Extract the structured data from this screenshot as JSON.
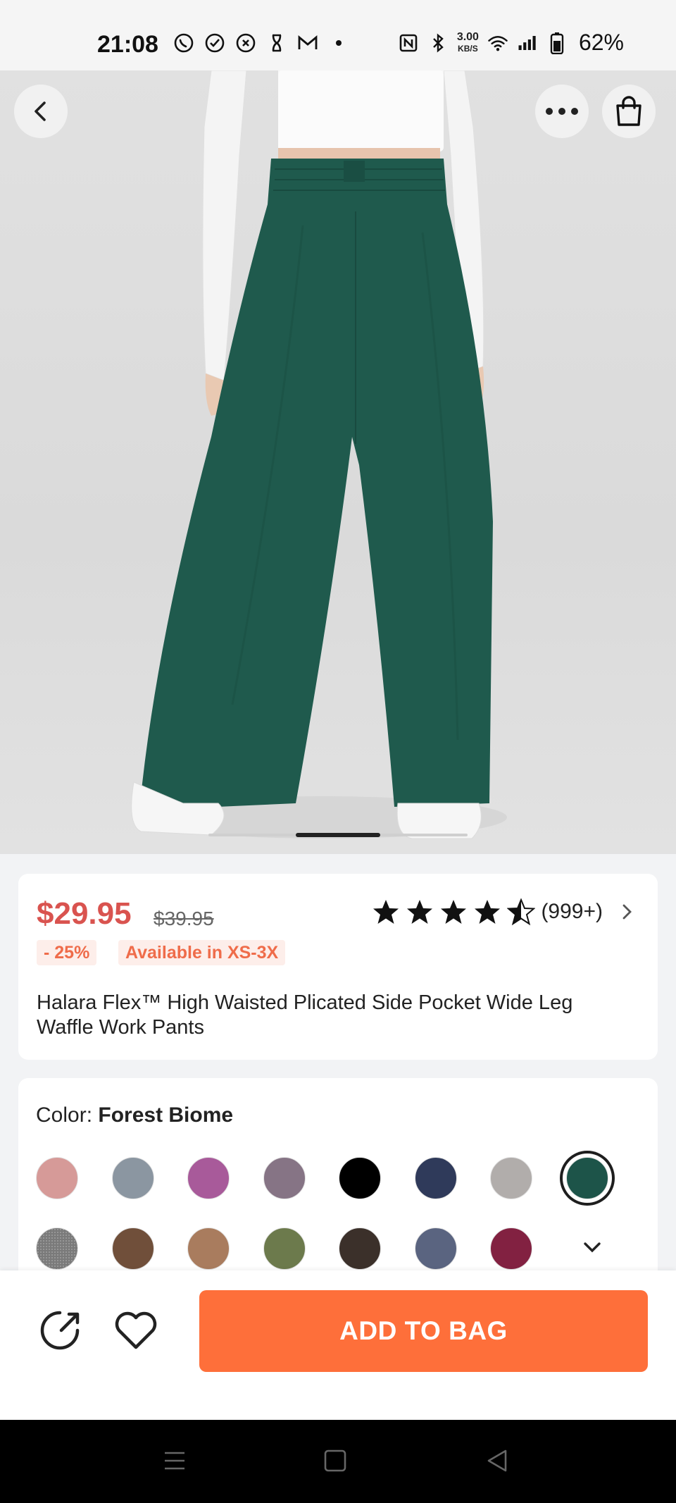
{
  "status_bar": {
    "time": "21:08",
    "left_icons": [
      "whatsapp-icon",
      "check-circle-icon",
      "shazam-icon",
      "hourglass-icon",
      "gmail-icon",
      "dot-icon"
    ],
    "network_speed_value": "3.00",
    "network_speed_unit": "KB/S",
    "battery_percent": "62%"
  },
  "hero": {
    "image_description_icons": [
      "back-arrow-icon",
      "more-dots-icon",
      "shopping-bag-icon"
    ],
    "carousel_index": 2,
    "carousel_count": 3
  },
  "product": {
    "price": "$29.95",
    "original_price": "$39.95",
    "rating_stars": 4.5,
    "rating_count": "(999+)",
    "discount_badge": "- 25%",
    "availability_badge": "Available in XS-3X",
    "title": "Halara Flex™ High Waisted Plicated Side Pocket Wide Leg Waffle Work Pants",
    "accent_price_color": "#d9534f"
  },
  "color_selector": {
    "label": "Color:",
    "selected_name": "Forest Biome",
    "swatches_row1": [
      "#d69a98",
      "#8b96a1",
      "#a85a9a",
      "#867485",
      "#000000",
      "#2f3a5a",
      "#b1adab",
      "#1d5449"
    ],
    "swatches_row2": [
      "#8c8c8c",
      "#704f3a",
      "#a97c5e",
      "#6c7a4c",
      "#3b302a",
      "#5a6480",
      "#822141"
    ],
    "selected_index": 7
  },
  "actions": {
    "add_to_bag_label": "ADD TO BAG",
    "button_color": "#fe6f3a"
  }
}
